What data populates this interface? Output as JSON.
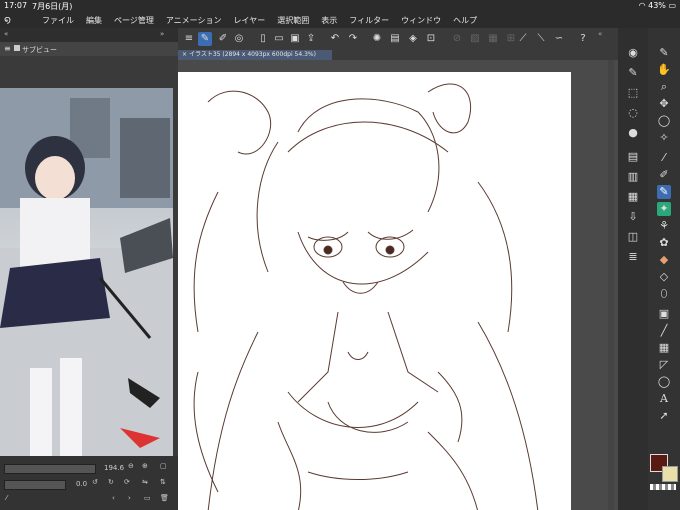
{
  "status": {
    "time": "17:07",
    "date": "7月6日(月)",
    "battery": "43%"
  },
  "menu": {
    "items": [
      "ファイル",
      "編集",
      "ページ管理",
      "アニメーション",
      "レイヤー",
      "選択範囲",
      "表示",
      "フィルター",
      "ウィンドウ",
      "ヘルプ"
    ]
  },
  "subview": {
    "tab_label": "サブビュー",
    "zoom_value": "194.6",
    "rotate_value": "0.0"
  },
  "document": {
    "tab_label": "イラスト35 (2894 x 4093px 600dpi 54.3%)"
  },
  "colors": {
    "accent": "#3c6db3",
    "main_color": "#5a1a14",
    "sub_color": "#e8e0a8"
  }
}
